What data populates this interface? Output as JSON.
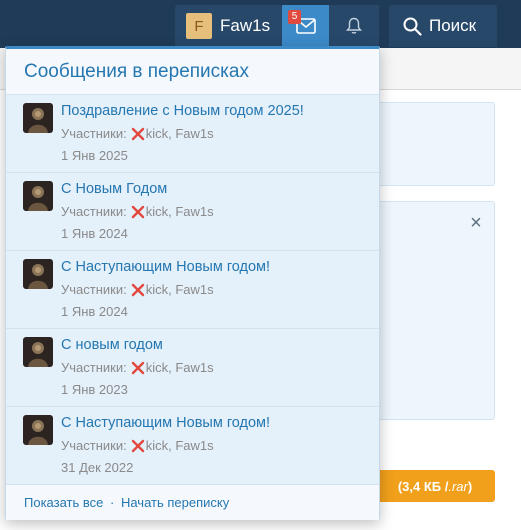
{
  "navbar": {
    "user": {
      "avatar_letter": "F",
      "name": "Faw1s"
    },
    "inbox": {
      "icon": "envelope-icon",
      "badge": "5"
    },
    "alerts": {
      "icon": "bell-icon"
    },
    "search": {
      "icon": "search-icon",
      "label": "Поиск"
    }
  },
  "page": {
    "download": {
      "size": "(3,4 КБ / ",
      "ext": ".rar",
      "close": ")"
    },
    "close_icon": "×"
  },
  "conversations_popup": {
    "title": "Сообщения в переписках",
    "participants_label": "Участники:",
    "items": [
      {
        "title": "Поздравление с Новым годом 2025!",
        "participant_1": "kick",
        "participant_2": "Faw1s",
        "date": "1 Янв 2025"
      },
      {
        "title": "С Новым Годом",
        "participant_1": "kick",
        "participant_2": "Faw1s",
        "date": "1 Янв 2024"
      },
      {
        "title": "С Наступающим Новым годом!",
        "participant_1": "kick",
        "participant_2": "Faw1s",
        "date": "1 Янв 2024"
      },
      {
        "title": "С новым годом",
        "participant_1": "kick",
        "participant_2": "Faw1s",
        "date": "1 Янв 2023"
      },
      {
        "title": "С Наступающим Новым годом!",
        "participant_1": "kick",
        "participant_2": "Faw1s",
        "date": "31 Дек 2022"
      }
    ],
    "footer": {
      "show_all": "Показать все",
      "separator": "·",
      "start_conversation": "Начать переписку"
    }
  },
  "colors": {
    "navbar_bg": "#1f3b57",
    "accent": "#3d8ac9",
    "link": "#2577b1",
    "badge": "#e04a3f",
    "download_button": "#f1a01b"
  }
}
